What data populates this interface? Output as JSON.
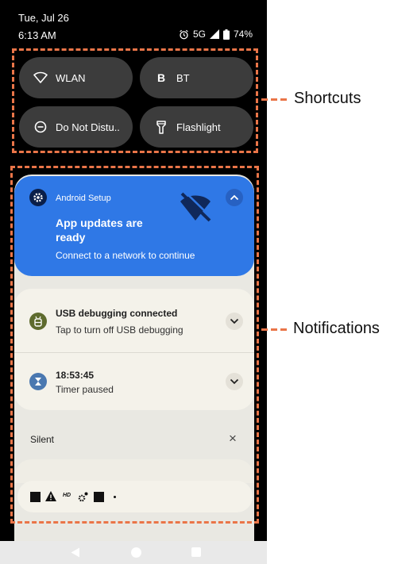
{
  "status": {
    "date": "Tue, Jul 26",
    "time": "6:13 AM",
    "network": "5G",
    "battery": "74%"
  },
  "tiles": [
    {
      "label": "WLAN",
      "icon": "wifi-icon"
    },
    {
      "label": "BT",
      "icon": "bluetooth-icon"
    },
    {
      "label": "Do Not Distu..",
      "icon": "do-not-disturb-icon"
    },
    {
      "label": "Flashlight",
      "icon": "flashlight-icon"
    }
  ],
  "setup": {
    "app": "Android Setup",
    "title_line1": "App updates are",
    "title_line2": "ready",
    "subtitle": "Connect to a network to continue"
  },
  "usb": {
    "title": "USB debugging connected",
    "subtitle": "Tap to turn off USB debugging"
  },
  "timer": {
    "title": "18:53:45",
    "subtitle": "Timer paused"
  },
  "silent": {
    "label": "Silent",
    "close": "×"
  },
  "tray": {
    "hd": "HD"
  },
  "callouts": {
    "shortcuts": "Shortcuts",
    "notifications": "Notifications"
  }
}
